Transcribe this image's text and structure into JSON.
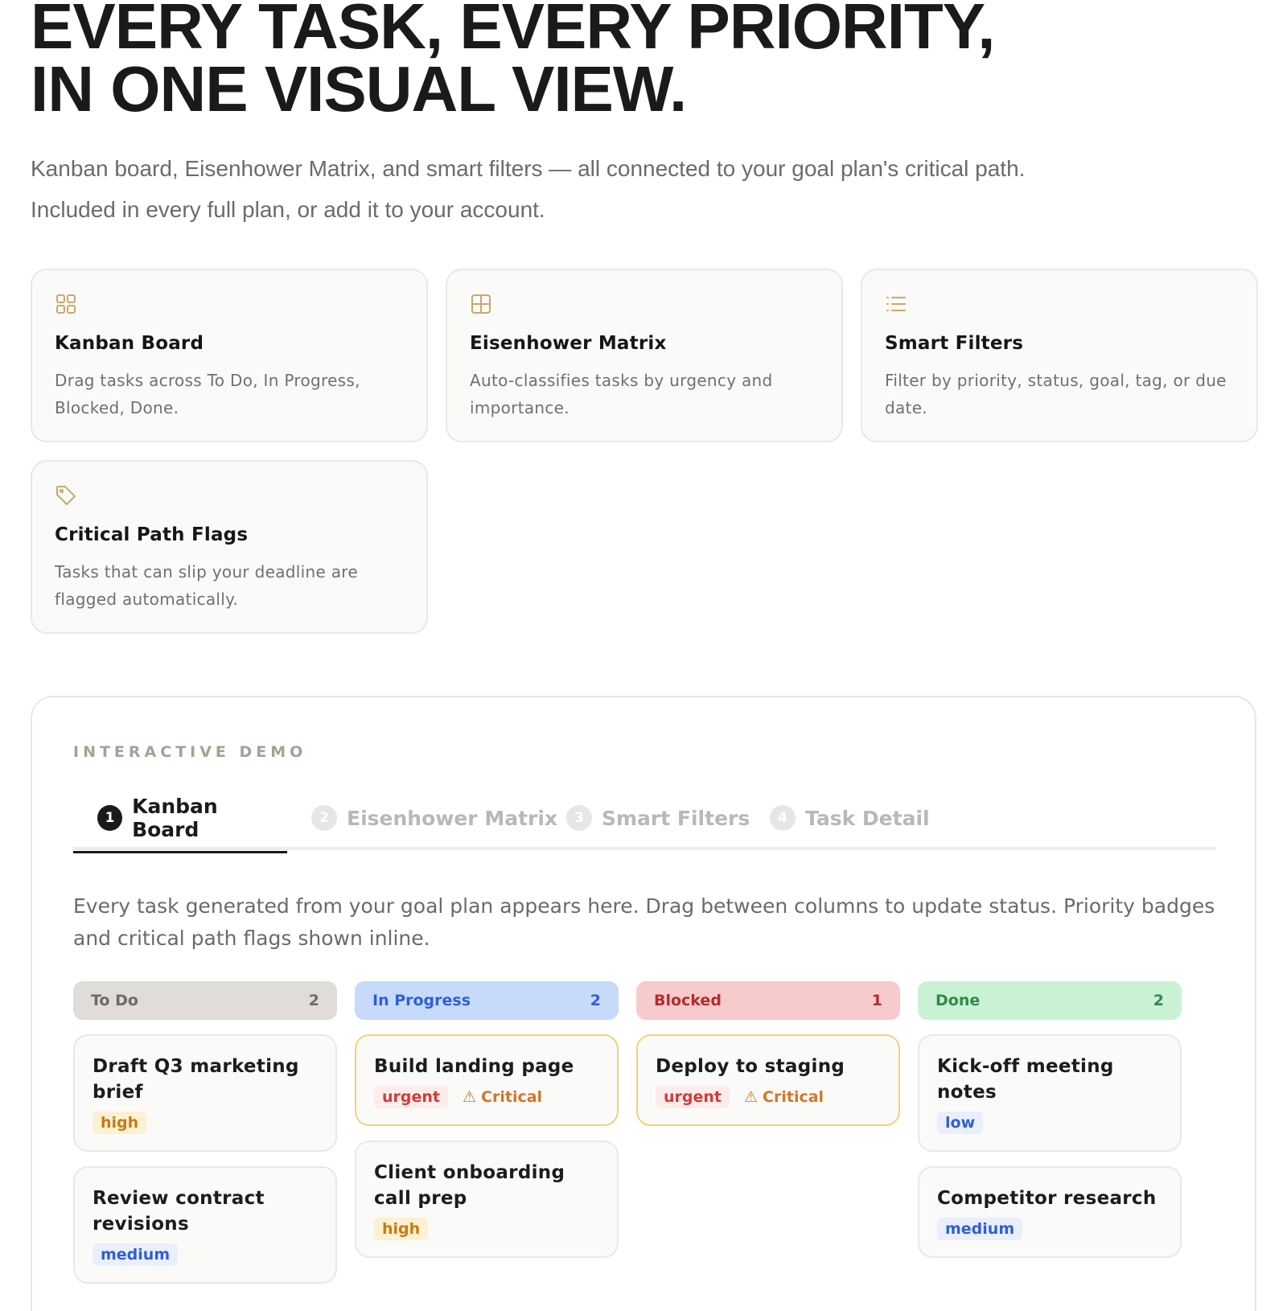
{
  "hero": {
    "title_line1": "EVERY TASK, EVERY PRIORITY,",
    "title_line2": "IN ONE VISUAL VIEW.",
    "subtitle": "Kanban board, Eisenhower Matrix, and smart filters — all connected to your goal plan's critical path. Included in every full plan, or add it to your account."
  },
  "features": [
    {
      "icon": "grid-icon",
      "title": "Kanban Board",
      "desc": "Drag tasks across To Do, In Progress, Blocked, Done."
    },
    {
      "icon": "matrix-icon",
      "title": "Eisenhower Matrix",
      "desc": "Auto-classifies tasks by urgency and importance."
    },
    {
      "icon": "list-icon",
      "title": "Smart Filters",
      "desc": "Filter by priority, status, goal, tag, or due date."
    },
    {
      "icon": "tag-icon",
      "title": "Critical Path Flags",
      "desc": "Tasks that can slip your deadline are flagged automatically."
    }
  ],
  "demo": {
    "eyebrow": "INTERACTIVE DEMO",
    "tabs": [
      {
        "num": "1",
        "label": "Kanban Board"
      },
      {
        "num": "2",
        "label": "Eisenhower Matrix"
      },
      {
        "num": "3",
        "label": "Smart Filters"
      },
      {
        "num": "4",
        "label": "Task Detail"
      }
    ],
    "description": "Every task generated from your goal plan appears here. Drag between columns to update status. Priority badges and critical path flags shown inline.",
    "columns": [
      {
        "name": "To Do",
        "count": "2",
        "bg": "#e0dcd7",
        "fg": "#6f6a63",
        "tasks": [
          {
            "title": "Draft Q3 marketing brief",
            "priority": "high"
          },
          {
            "title": "Review contract revisions",
            "priority": "medium"
          }
        ]
      },
      {
        "name": "In Progress",
        "count": "2",
        "bg": "#c7dafa",
        "fg": "#2f5fd6",
        "tasks": [
          {
            "title": "Build landing page",
            "priority": "urgent",
            "flag": "Critical"
          },
          {
            "title": "Client onboarding call prep",
            "priority": "high"
          }
        ]
      },
      {
        "name": "Blocked",
        "count": "1",
        "bg": "#f7cbcb",
        "fg": "#b12c2c",
        "tasks": [
          {
            "title": "Deploy to staging",
            "priority": "urgent",
            "flag": "Critical"
          }
        ]
      },
      {
        "name": "Done",
        "count": "2",
        "bg": "#c8f2d3",
        "fg": "#2f8a49",
        "tasks": [
          {
            "title": "Kick-off meeting notes",
            "priority": "low"
          },
          {
            "title": "Competitor research",
            "priority": "medium"
          }
        ]
      }
    ],
    "flag_symbol": "⚠"
  },
  "colors": {
    "accent_icon": "#c9a86b",
    "critical_border": "#f0d27a"
  }
}
